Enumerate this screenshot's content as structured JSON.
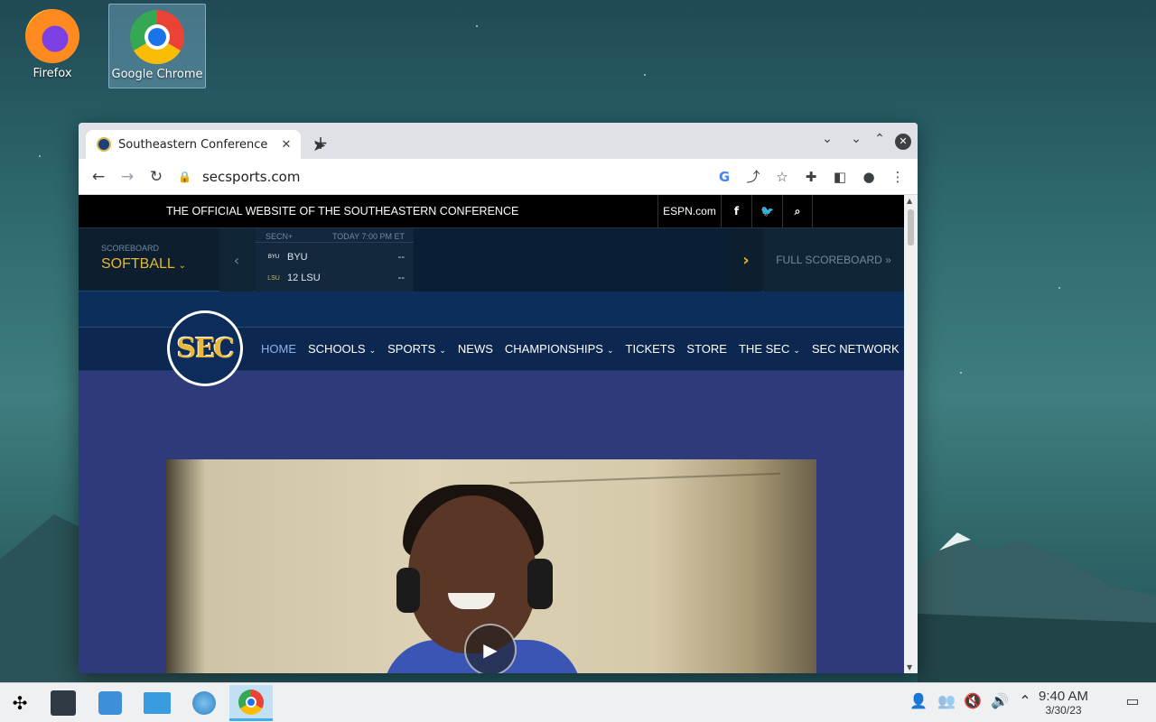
{
  "desktop": {
    "icons": [
      {
        "label": "Firefox"
      },
      {
        "label": "Google Chrome"
      }
    ]
  },
  "browser": {
    "tab_title": "Southeastern Conference",
    "tab_close": "✕",
    "new_tab": "+",
    "url": "secsports.com"
  },
  "site": {
    "official_text": "THE OFFICIAL WEBSITE OF THE SOUTHEASTERN CONFERENCE",
    "espn_link": "ESPN.com",
    "scoreboard": {
      "label": "SCOREBOARD",
      "sport": "SOFTBALL",
      "game": {
        "network": "SECN+",
        "time": "TODAY 7:00 PM ET",
        "teams": [
          {
            "logo": "BYU",
            "name": "BYU",
            "score": "--"
          },
          {
            "logo": "LSU",
            "name": "12 LSU",
            "score": "--"
          }
        ]
      },
      "full_scoreboard": "FULL SCOREBOARD »"
    },
    "logo_text": "SEC",
    "nav": [
      {
        "label": "HOME",
        "caret": false
      },
      {
        "label": "SCHOOLS",
        "caret": true
      },
      {
        "label": "SPORTS",
        "caret": true
      },
      {
        "label": "NEWS",
        "caret": false
      },
      {
        "label": "CHAMPIONSHIPS",
        "caret": true
      },
      {
        "label": "TICKETS",
        "caret": false
      },
      {
        "label": "STORE",
        "caret": false
      },
      {
        "label": "THE SEC",
        "caret": true
      },
      {
        "label": "SEC NETWORK",
        "caret": true
      }
    ]
  },
  "taskbar": {
    "time": "9:40 AM",
    "date": "3/30/23"
  },
  "colors": {
    "sec_gold": "#e3b832",
    "sec_navy": "#0c2750",
    "hero_bg": "#2e3a7c"
  }
}
